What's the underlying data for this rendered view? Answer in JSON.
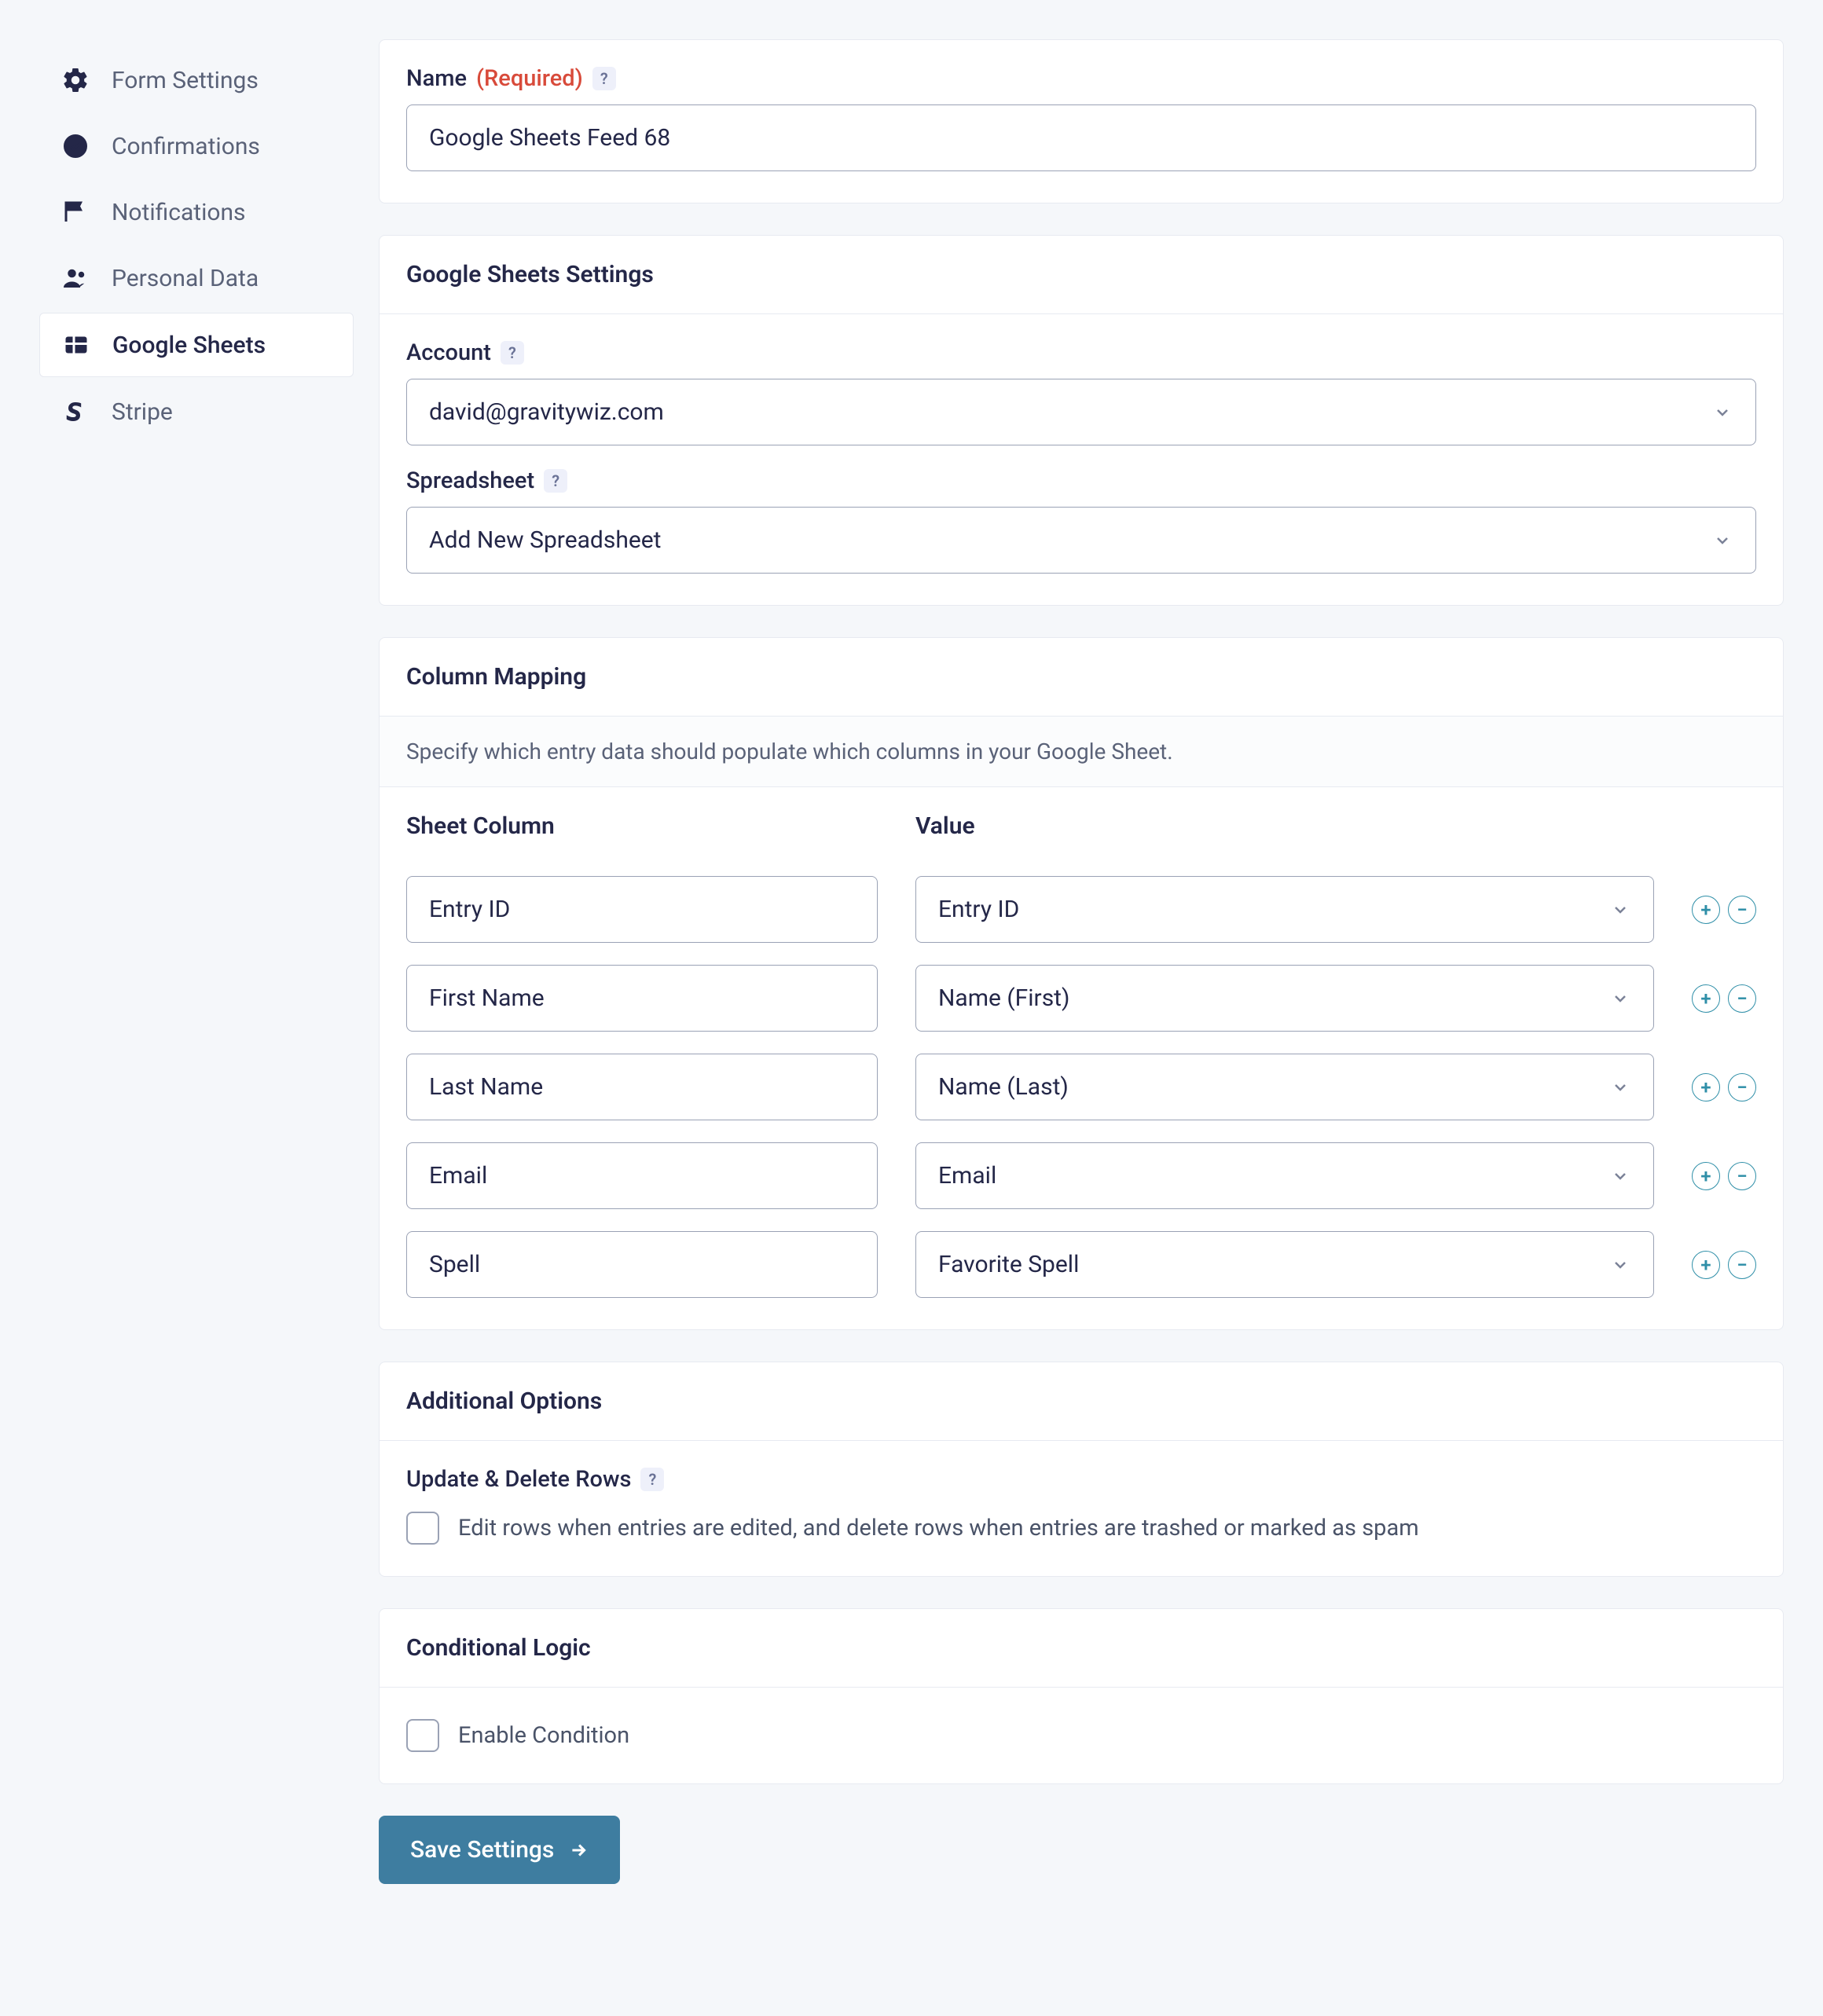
{
  "sidebar": {
    "items": [
      {
        "label": "Form Settings"
      },
      {
        "label": "Confirmations"
      },
      {
        "label": "Notifications"
      },
      {
        "label": "Personal Data"
      },
      {
        "label": "Google Sheets"
      },
      {
        "label": "Stripe"
      }
    ]
  },
  "nameCard": {
    "label": "Name",
    "required": "(Required)",
    "value": "Google Sheets Feed 68"
  },
  "gsheets": {
    "heading": "Google Sheets Settings",
    "account_label": "Account",
    "account_value": "david@gravitywiz.com",
    "spreadsheet_label": "Spreadsheet",
    "spreadsheet_value": "Add New Spreadsheet"
  },
  "mapping": {
    "heading": "Column Mapping",
    "description": "Specify which entry data should populate which columns in your Google Sheet.",
    "sheet_col_header": "Sheet Column",
    "value_header": "Value",
    "rows": [
      {
        "column": "Entry ID",
        "value": "Entry ID"
      },
      {
        "column": "First Name",
        "value": "Name (First)"
      },
      {
        "column": "Last Name",
        "value": "Name (Last)"
      },
      {
        "column": "Email",
        "value": "Email"
      },
      {
        "column": "Spell",
        "value": "Favorite Spell"
      }
    ]
  },
  "additional": {
    "heading": "Additional Options",
    "update_delete_label": "Update & Delete Rows",
    "update_delete_desc": "Edit rows when entries are edited, and delete rows when entries are trashed or marked as spam"
  },
  "conditional": {
    "heading": "Conditional Logic",
    "enable_label": "Enable Condition"
  },
  "save_label": "Save Settings"
}
